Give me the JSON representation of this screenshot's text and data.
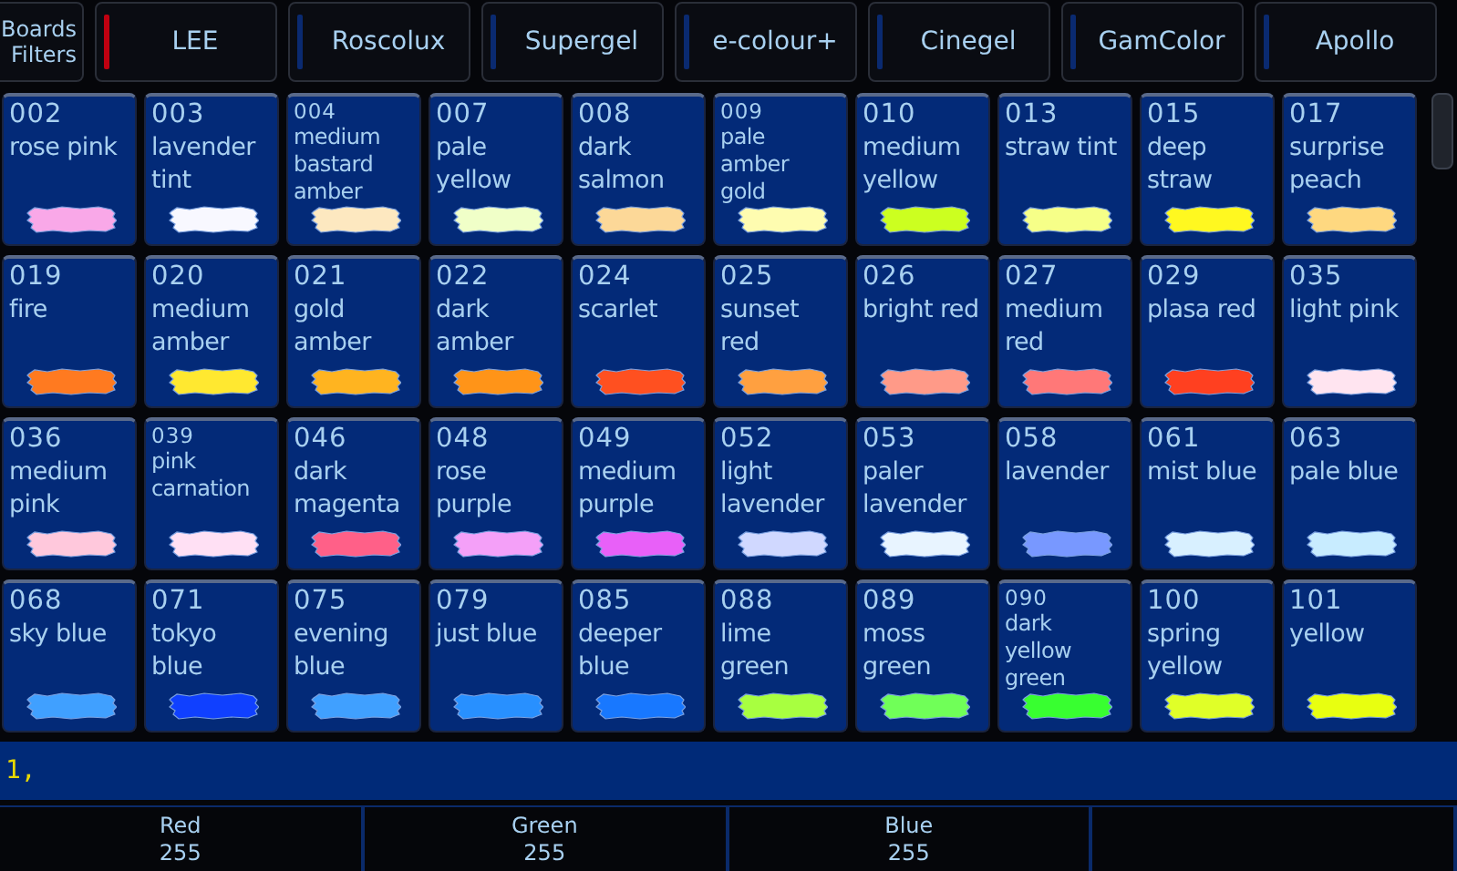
{
  "boards_button": {
    "label": "Boards Filters"
  },
  "tabs": [
    {
      "label": "LEE",
      "selected": true
    },
    {
      "label": "Roscolux",
      "selected": false
    },
    {
      "label": "Supergel",
      "selected": false
    },
    {
      "label": "e-colour+",
      "selected": false
    },
    {
      "label": "Cinegel",
      "selected": false
    },
    {
      "label": "GamColor",
      "selected": false
    },
    {
      "label": "Apollo",
      "selected": false
    }
  ],
  "gels": [
    {
      "number": "002",
      "name": "rose pink",
      "color": "#f9a8e8",
      "compact": false
    },
    {
      "number": "003",
      "name": "lavender tint",
      "color": "#f8f8ff",
      "compact": false
    },
    {
      "number": "004",
      "name": "medium bastard amber",
      "color": "#fde8c0",
      "compact": true
    },
    {
      "number": "007",
      "name": "pale yellow",
      "color": "#f0ffc8",
      "compact": false
    },
    {
      "number": "008",
      "name": "dark salmon",
      "color": "#fcd898",
      "compact": false
    },
    {
      "number": "009",
      "name": "pale amber gold",
      "color": "#fefcb0",
      "compact": true
    },
    {
      "number": "010",
      "name": "medium yellow",
      "color": "#ccff20",
      "compact": false
    },
    {
      "number": "013",
      "name": "straw tint",
      "color": "#f6ff88",
      "compact": false
    },
    {
      "number": "015",
      "name": "deep straw",
      "color": "#fff820",
      "compact": false
    },
    {
      "number": "017",
      "name": "surprise peach",
      "color": "#fed880",
      "compact": false
    },
    {
      "number": "019",
      "name": "fire",
      "color": "#ff7a20",
      "compact": false
    },
    {
      "number": "020",
      "name": "medium amber",
      "color": "#ffe830",
      "compact": false
    },
    {
      "number": "021",
      "name": "gold amber",
      "color": "#ffb420",
      "compact": false
    },
    {
      "number": "022",
      "name": "dark amber",
      "color": "#ff9418",
      "compact": false
    },
    {
      "number": "024",
      "name": "scarlet",
      "color": "#ff5020",
      "compact": false
    },
    {
      "number": "025",
      "name": "sunset red",
      "color": "#ffa040",
      "compact": false
    },
    {
      "number": "026",
      "name": "bright red",
      "color": "#ff9a88",
      "compact": false
    },
    {
      "number": "027",
      "name": "medium red",
      "color": "#ff7878",
      "compact": false
    },
    {
      "number": "029",
      "name": "plasa red",
      "color": "#ff4020",
      "compact": false
    },
    {
      "number": "035",
      "name": "light pink",
      "color": "#ffe4f0",
      "compact": false
    },
    {
      "number": "036",
      "name": "medium pink",
      "color": "#ffc8dc",
      "compact": false
    },
    {
      "number": "039",
      "name": "pink carnation",
      "color": "#ffe0f4",
      "compact": true
    },
    {
      "number": "046",
      "name": "dark magenta",
      "color": "#ff6088",
      "compact": false
    },
    {
      "number": "048",
      "name": "rose purple",
      "color": "#f4a0f8",
      "compact": false
    },
    {
      "number": "049",
      "name": "medium purple",
      "color": "#e860f8",
      "compact": false
    },
    {
      "number": "052",
      "name": "light lavender",
      "color": "#d0d8ff",
      "compact": false
    },
    {
      "number": "053",
      "name": "paler lavender",
      "color": "#e8f4ff",
      "compact": false
    },
    {
      "number": "058",
      "name": "lavender",
      "color": "#7898ff",
      "compact": false
    },
    {
      "number": "061",
      "name": "mist blue",
      "color": "#d8f0ff",
      "compact": false
    },
    {
      "number": "063",
      "name": "pale blue",
      "color": "#c8ecff",
      "compact": false
    },
    {
      "number": "068",
      "name": "sky blue",
      "color": "#40a0ff",
      "compact": false
    },
    {
      "number": "071",
      "name": "tokyo blue",
      "color": "#1040ff",
      "compact": false
    },
    {
      "number": "075",
      "name": "evening blue",
      "color": "#40a0ff",
      "compact": false
    },
    {
      "number": "079",
      "name": "just blue",
      "color": "#2890ff",
      "compact": false
    },
    {
      "number": "085",
      "name": "deeper blue",
      "color": "#1878ff",
      "compact": false
    },
    {
      "number": "088",
      "name": "lime green",
      "color": "#a8ff40",
      "compact": false
    },
    {
      "number": "089",
      "name": "moss green",
      "color": "#70ff58",
      "compact": false
    },
    {
      "number": "090",
      "name": "dark yellow green",
      "color": "#38ff30",
      "compact": true
    },
    {
      "number": "100",
      "name": "spring yellow",
      "color": "#e0ff28",
      "compact": false
    },
    {
      "number": "101",
      "name": "yellow",
      "color": "#e8ff10",
      "compact": false
    }
  ],
  "command_line": {
    "text": "1,"
  },
  "parameters": [
    {
      "label": "Red",
      "value": "255"
    },
    {
      "label": "Green",
      "value": "255"
    },
    {
      "label": "Blue",
      "value": "255"
    }
  ]
}
